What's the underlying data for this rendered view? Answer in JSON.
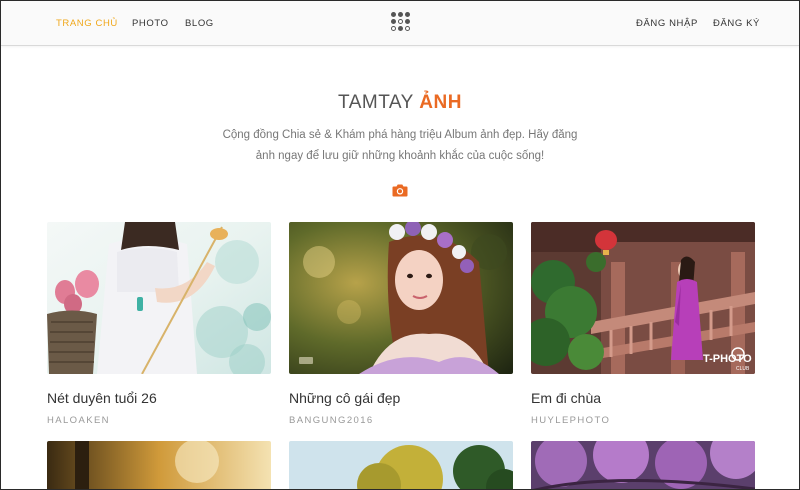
{
  "nav": {
    "left": [
      {
        "label": "TRANG CHỦ",
        "active": true
      },
      {
        "label": "PHOTO",
        "active": false
      },
      {
        "label": "BLOG",
        "active": false
      }
    ],
    "right": [
      {
        "label": "ĐĂNG NHẬP"
      },
      {
        "label": "ĐĂNG KÝ"
      }
    ],
    "logo_icon": "dots-grid-logo"
  },
  "hero": {
    "title_part1": "TAMTAY",
    "title_part2": "ẢNH",
    "description": "Cộng đồng Chia sẻ & Khám phá hàng triệu Album ảnh đẹp. Hãy đăng ảnh ngay để lưu giữ những khoảnh khắc của cuộc sống!",
    "icon": "camera-icon"
  },
  "albums": [
    {
      "title": "Nét duyên tuổi 26",
      "author": "HALOAKEN"
    },
    {
      "title": "Những cô gái đẹp",
      "author": "BANGUNG2016"
    },
    {
      "title": "Em đi chùa",
      "author": "HUYLEPHOTO"
    }
  ],
  "watermark": {
    "main": "T-PHOTO",
    "sub": "CLUB"
  },
  "colors": {
    "accent": "#f0a81c",
    "title_accent": "#ea6a23"
  }
}
